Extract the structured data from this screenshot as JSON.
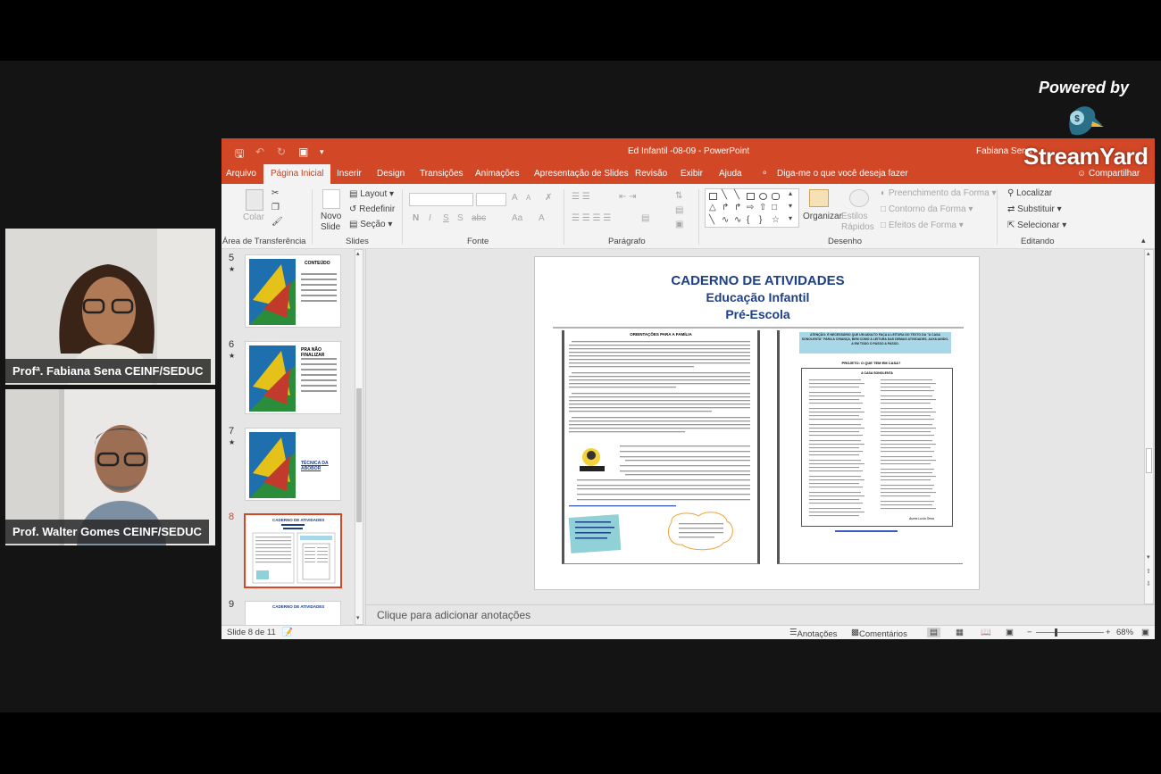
{
  "branding": {
    "powered_by": "Powered by",
    "name": "StreamYard"
  },
  "participants": [
    {
      "name": "Profª. Fabiana Sena CEINF/SEDUC"
    },
    {
      "name": "Prof. Walter Gomes CEINF/SEDUC"
    }
  ],
  "powerpoint": {
    "window_title": "Ed Infantil -08-09  -  PowerPoint",
    "user": "Fabiana Sena",
    "tabs": [
      "Arquivo",
      "Página Inicial",
      "Inserir",
      "Design",
      "Transições",
      "Animações",
      "Apresentação de Slides",
      "Revisão",
      "Exibir",
      "Ajuda",
      "Diga-me o que você deseja fazer"
    ],
    "active_tab": "Página Inicial",
    "share": "Compartilhar",
    "ribbon": {
      "clipboard": {
        "paste": "Colar",
        "label": "Área de Transferência"
      },
      "slides": {
        "new_slide": "Novo Slide",
        "layout": "Layout",
        "reset": "Redefinir",
        "section": "Seção",
        "label": "Slides"
      },
      "font": {
        "bold": "N",
        "italic": "I",
        "underline": "S",
        "shadow": "S",
        "strike": "abc",
        "case": "Aa",
        "color": "A",
        "grow": "A",
        "shrink": "A",
        "label": "Fonte"
      },
      "paragraph": {
        "label": "Parágrafo"
      },
      "drawing": {
        "arrange": "Organizar",
        "quick_styles": "Estilos Rápidos",
        "fill": "Preenchimento da Forma",
        "outline": "Contorno da Forma",
        "effects": "Efeitos de Forma",
        "label": "Desenho"
      },
      "editing": {
        "find": "Localizar",
        "replace": "Substituir",
        "select": "Selecionar",
        "label": "Editando"
      }
    },
    "thumbnails": [
      {
        "num": "5",
        "star": "★",
        "text": "CONTEÚDO"
      },
      {
        "num": "6",
        "star": "★",
        "text": "PRA NÃO FINALIZAR"
      },
      {
        "num": "7",
        "star": "★",
        "text": "TÉCNICA DA ABOBOR"
      },
      {
        "num": "8",
        "star": "",
        "text": "CADERNO DE ATIVIDADES"
      },
      {
        "num": "9",
        "star": "",
        "text": "CADERNO DE ATIVIDADES"
      }
    ],
    "selected_slide": "8",
    "slide": {
      "title": "CADERNO DE ATIVIDADES",
      "subtitle1": "Educação Infantil",
      "subtitle2": "Pré-Escola",
      "left_heading": "ORIENTAÇÕES PARA A FAMÍLIA",
      "right_banner": "ATENÇÃO: É NECESSÁRIO QUE UM ADULTO FAÇA A LEITURA DO TEXTO DA \"A CASA SONOLENTA\" PARA A CRIANÇA, BEM COMO A LEITURA DAS DEMAIS ATIVIDADES, AUXILIANDO-A EM TODO O PASSO A PASSO.",
      "right_heading": "PROJETO: O QUE TEM EM CASA?",
      "poem_title": "A CASA SONOLENTA",
      "author": "Aurea Lucia Sena"
    },
    "notes_placeholder": "Clique para adicionar anotações",
    "status": {
      "slide_info": "Slide 8 de 11",
      "notes": "Anotações",
      "comments": "Comentários",
      "zoom": "68%"
    }
  }
}
